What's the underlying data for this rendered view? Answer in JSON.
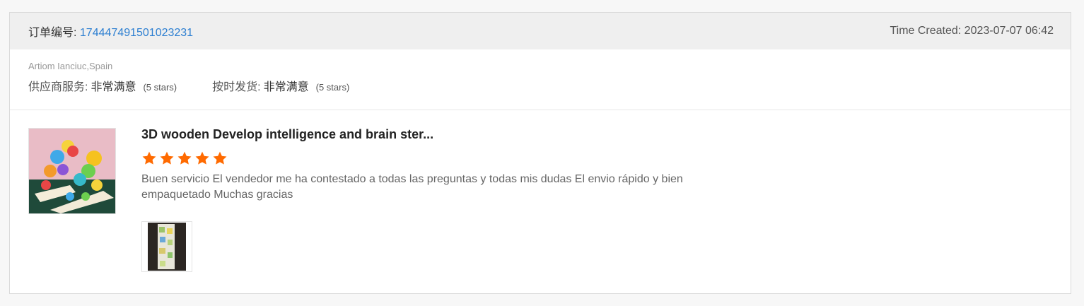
{
  "order": {
    "label": "订单编号: ",
    "number": "174447491501023231",
    "time_created": "Time Created: 2023-07-07 06:42"
  },
  "buyer": {
    "name_country": "Artiom Ianciuc,Spain"
  },
  "ratings": [
    {
      "label": "供应商服务:",
      "value": "非常满意",
      "stars_text": "(5 stars)"
    },
    {
      "label": "按时发货:",
      "value": "非常满意",
      "stars_text": "(5 stars)"
    }
  ],
  "review": {
    "product_title": "3D wooden Develop intelligence and brain ster...",
    "star_rating": 5,
    "star_color": "#ff6a00",
    "text": "Buen servicio El vendedor me ha contestado a todas las preguntas y todas mis dudas El envio rápido y bien empaquetado Muchas gracias"
  },
  "colors": {
    "link": "#2d7fd1",
    "header_bg": "#efefef"
  }
}
